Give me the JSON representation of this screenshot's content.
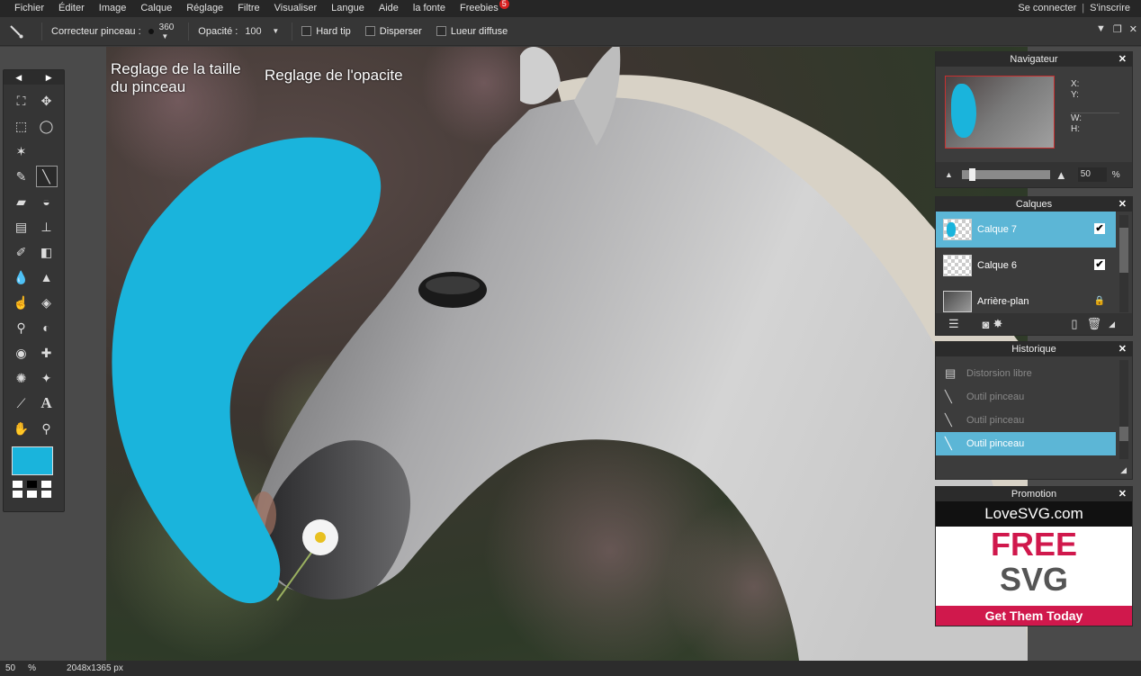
{
  "menubar": {
    "items": [
      "Fichier",
      "Éditer",
      "Image",
      "Calque",
      "Réglage",
      "Filtre",
      "Visualiser",
      "Langue",
      "Aide",
      "la fonte",
      "Freebies"
    ],
    "freebies_badge": "5",
    "login": "Se connecter",
    "auth_sep": "|",
    "register": "S'inscrire"
  },
  "options": {
    "brush_label": "Correcteur pinceau :",
    "brush_size": "360",
    "opacity_label": "Opacité :",
    "opacity_value": "100",
    "hard_tip": "Hard tip",
    "scatter": "Disperser",
    "glow": "Lueur diffuse"
  },
  "annotations": {
    "brush_size": "Reglage de la taille du pinceau",
    "opacity": "Reglage de l'opacite"
  },
  "toolbox": {
    "foreground_color": "#1ab4dc",
    "tools": [
      "crop-icon",
      "move-icon",
      "marquee-icon",
      "lasso-icon",
      "magic-wand-icon",
      "pencil-icon",
      "brush-icon",
      "eraser-icon",
      "paint-bucket-icon",
      "gradient-icon",
      "clone-stamp-icon",
      "color-replace-icon",
      "shape-icon",
      "blur-icon",
      "sharpen-icon",
      "smudge-icon",
      "sponge-icon",
      "dodge-icon",
      "burn-icon",
      "red-eye-icon",
      "spot-heal-icon",
      "bloat-icon",
      "pinch-icon",
      "color-picker-icon",
      "type-icon",
      "hand-icon",
      "zoom-icon"
    ]
  },
  "navigator": {
    "title": "Navigateur",
    "x_label": "X:",
    "y_label": "Y:",
    "w_label": "W:",
    "h_label": "H:",
    "zoom": "50",
    "zoom_unit": "%"
  },
  "layers": {
    "title": "Calques",
    "items": [
      {
        "name": "Calque 7",
        "selected": true
      },
      {
        "name": "Calque 6",
        "selected": false
      },
      {
        "name": "Arrière-plan",
        "selected": false
      }
    ]
  },
  "history": {
    "title": "Historique",
    "items": [
      {
        "label": "Distorsion libre"
      },
      {
        "label": "Outil pinceau"
      },
      {
        "label": "Outil pinceau"
      },
      {
        "label": "Outil pinceau"
      }
    ]
  },
  "promotion": {
    "title": "Promotion",
    "brand": "LoveSVG.com",
    "headline1": "FREE",
    "headline2": "SVG",
    "cta": "Get Them Today"
  },
  "status": {
    "zoom": "50",
    "zoom_unit": "%",
    "dimensions": "2048x1365 px"
  },
  "colors": {
    "accent": "#5cb6d6",
    "paint": "#1ab4dc",
    "promo_red": "#d0184c"
  }
}
